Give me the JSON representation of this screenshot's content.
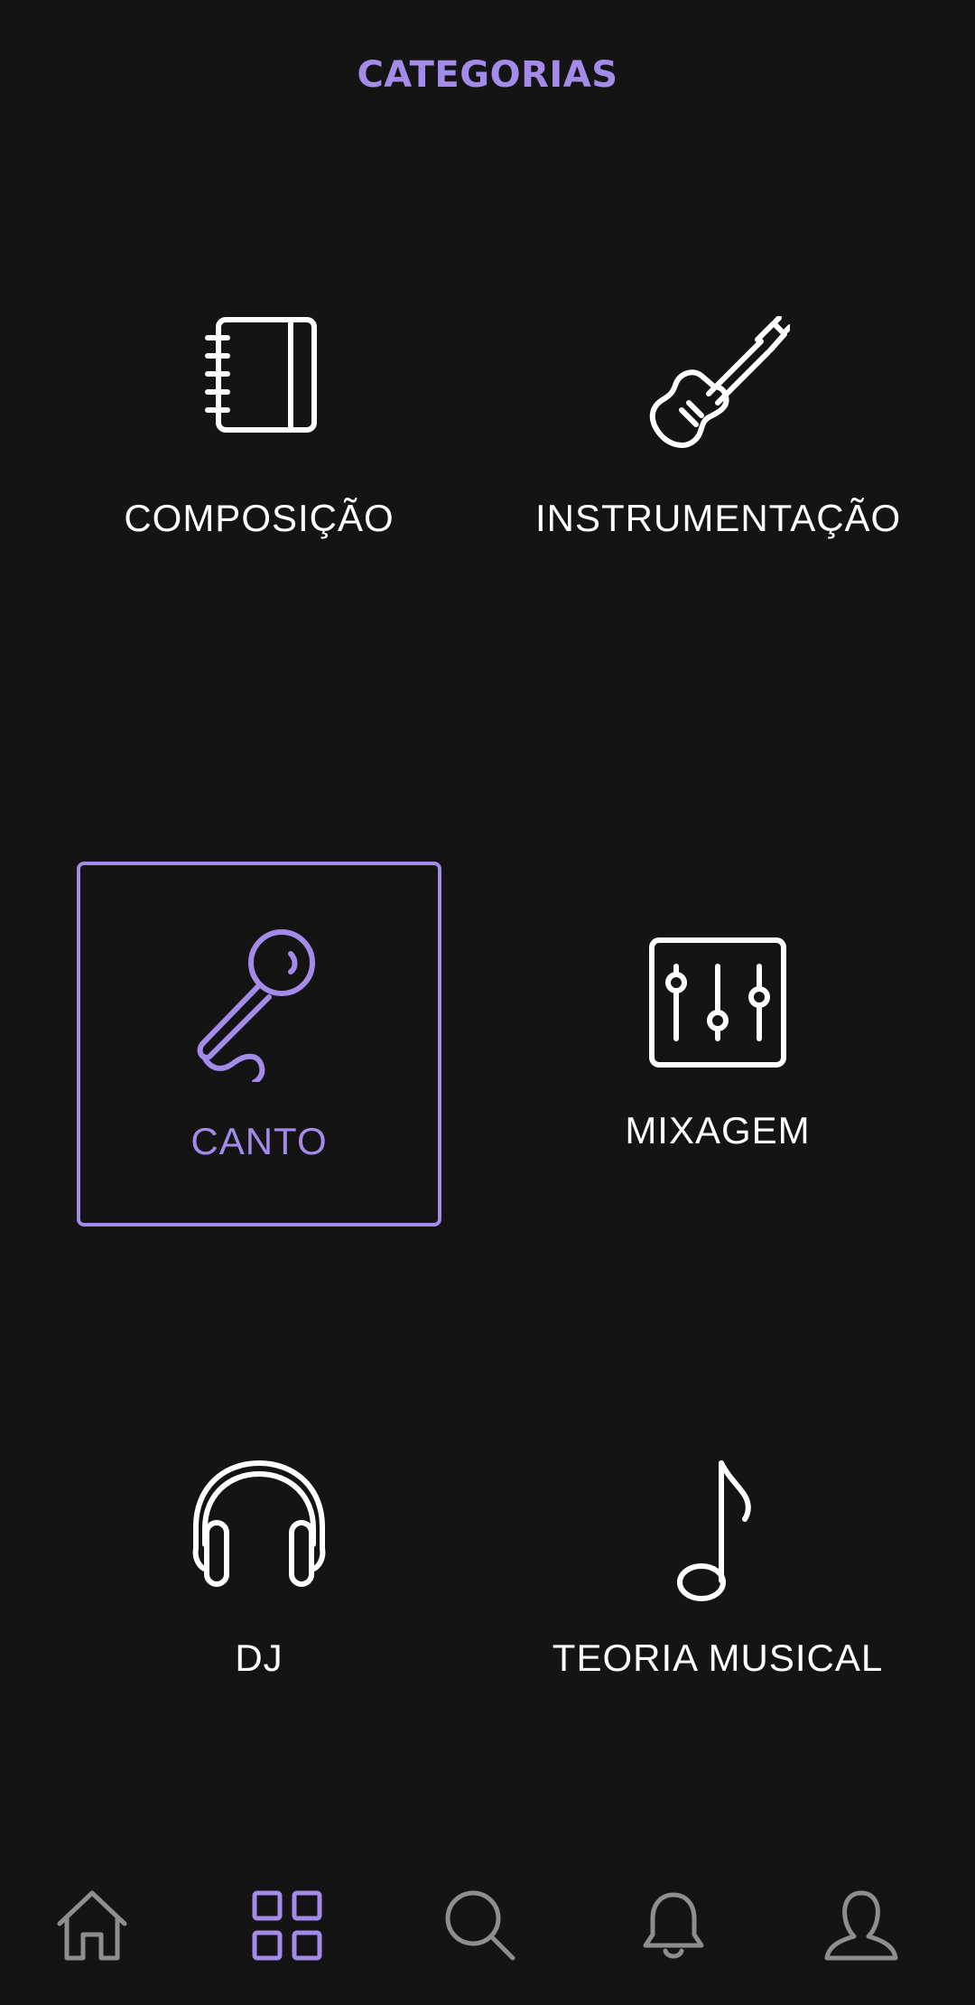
{
  "header": {
    "title": "CATEGORIAS"
  },
  "categories": [
    {
      "label": "COMPOSIÇÃO",
      "icon": "notebook-icon",
      "selected": false
    },
    {
      "label": "INSTRUMENTAÇÃO",
      "icon": "guitar-icon",
      "selected": false
    },
    {
      "label": "CANTO",
      "icon": "microphone-icon",
      "selected": true
    },
    {
      "label": "MIXAGEM",
      "icon": "mixer-sliders-icon",
      "selected": false
    },
    {
      "label": "DJ",
      "icon": "headphones-icon",
      "selected": false
    },
    {
      "label": "TEORIA MUSICAL",
      "icon": "music-note-icon",
      "selected": false
    }
  ],
  "bottom_nav": {
    "items": [
      {
        "icon": "home-icon",
        "active": false
      },
      {
        "icon": "grid-icon",
        "active": true
      },
      {
        "icon": "search-icon",
        "active": false
      },
      {
        "icon": "bell-icon",
        "active": false
      },
      {
        "icon": "profile-icon",
        "active": false
      }
    ]
  },
  "colors": {
    "background": "#141414",
    "accent": "#a38bea",
    "text": "#ffffff",
    "nav_inactive": "#8e8e8e"
  }
}
